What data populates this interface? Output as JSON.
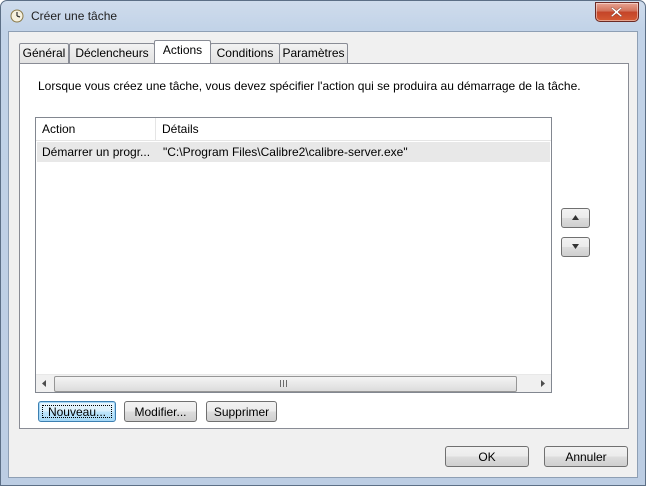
{
  "window": {
    "title": "Créer une tâche"
  },
  "tabs": [
    {
      "label": "Général",
      "active": false
    },
    {
      "label": "Déclencheurs",
      "active": false
    },
    {
      "label": "Actions",
      "active": true
    },
    {
      "label": "Conditions",
      "active": false
    },
    {
      "label": "Paramètres",
      "active": false
    }
  ],
  "actions_panel": {
    "description": "Lorsque vous créez une tâche, vous devez spécifier l'action qui se produira au démarrage de la tâche.",
    "columns": [
      "Action",
      "Détails"
    ],
    "rows": [
      {
        "action": "Démarrer un progr...",
        "details": "\"C:\\Program Files\\Calibre2\\calibre-server.exe\""
      }
    ],
    "buttons": {
      "new": "Nouveau...",
      "modify": "Modifier...",
      "delete": "Supprimer"
    }
  },
  "footer": {
    "ok": "OK",
    "cancel": "Annuler"
  },
  "icons": {
    "title": "clock-icon",
    "close": "close-icon",
    "move_up": "arrow-up-icon",
    "move_down": "arrow-down-icon",
    "scroll_left": "scroll-left-icon",
    "scroll_right": "scroll-right-icon",
    "thumb_grip": "scroll-grip-icon"
  },
  "colors": {
    "close_button": "#c44428",
    "default_button_border": "#3c7fb1",
    "selected_row": "#e8e8e8"
  }
}
